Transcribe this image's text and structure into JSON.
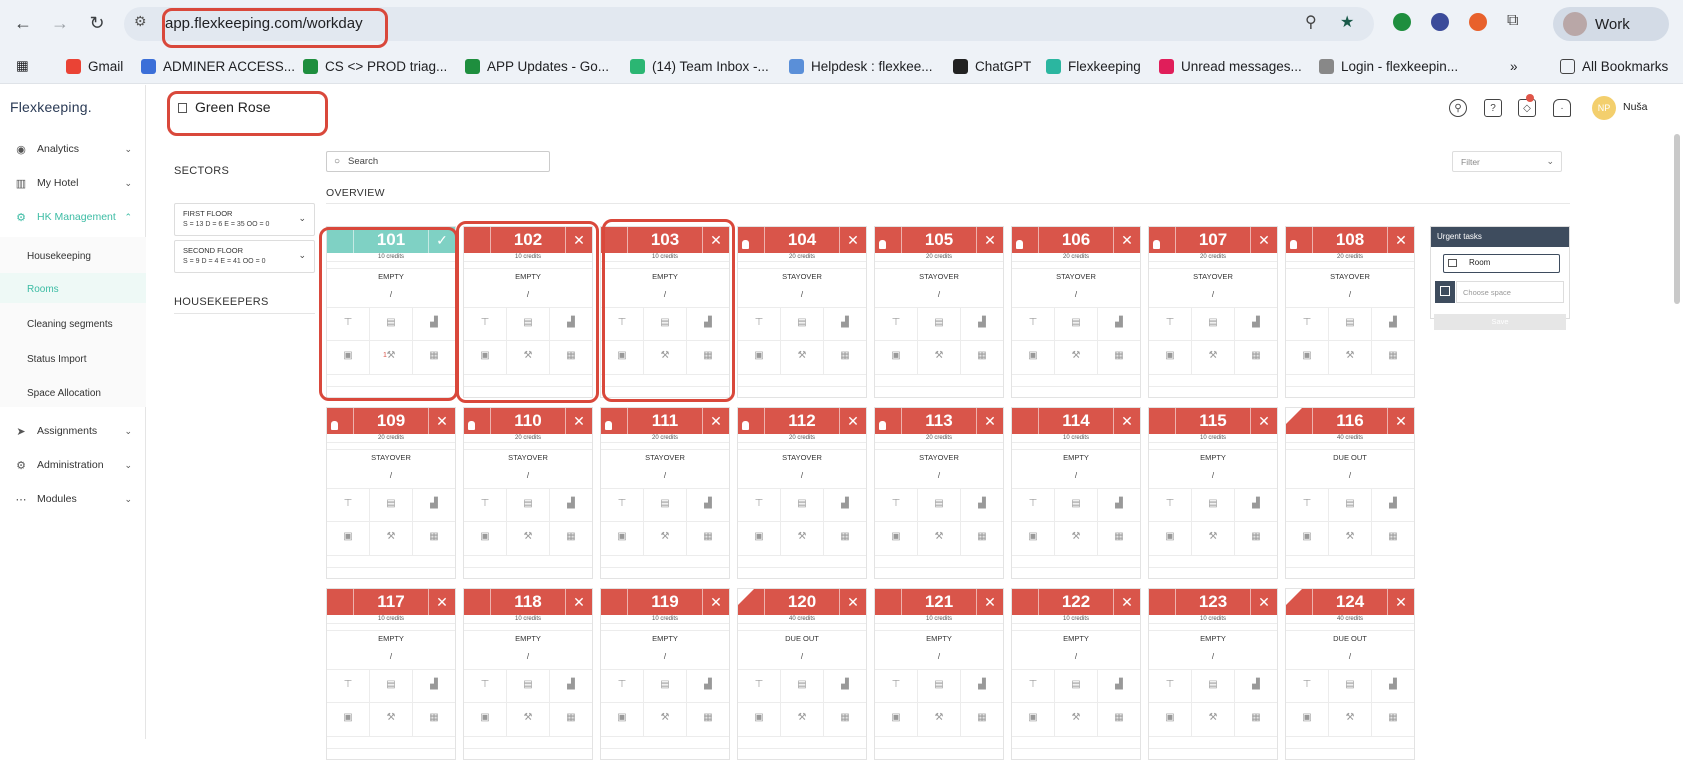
{
  "browser": {
    "url": "app.flexkeeping.com/workday",
    "profile_label": "Work",
    "bookmarks": [
      {
        "label": "Gmail",
        "color": "#ea4335"
      },
      {
        "label": "ADMINER ACCESS...",
        "color": "#3b6fd8"
      },
      {
        "label": "CS <> PROD triag...",
        "color": "#1e8e3e"
      },
      {
        "label": "APP Updates - Go...",
        "color": "#1e8e3e"
      },
      {
        "label": "(14) Team Inbox -...",
        "color": "#2bb673"
      },
      {
        "label": "Helpdesk : flexkee...",
        "color": "#5a8fd8"
      },
      {
        "label": "ChatGPT",
        "color": "#222222"
      },
      {
        "label": "Flexkeeping",
        "color": "#2bb6a0"
      },
      {
        "label": "Unread messages...",
        "color": "#e01e5a"
      },
      {
        "label": "Login - flexkeepin...",
        "color": "#888888"
      }
    ],
    "all_bookmarks": "All Bookmarks",
    "more": "»"
  },
  "app": {
    "logo": "Flexkeeping.",
    "hotel_name": "Green Rose",
    "user_initials": "NP",
    "user_name": "Nuša",
    "notification_count": "",
    "sidebar": [
      {
        "label": "Analytics",
        "icon": "eye-icon"
      },
      {
        "label": "My Hotel",
        "icon": "building-icon"
      },
      {
        "label": "HK Management",
        "icon": "gear-icon"
      },
      {
        "label": "Assignments",
        "icon": "send-icon"
      },
      {
        "label": "Administration",
        "icon": "gear-icon"
      },
      {
        "label": "Modules",
        "icon": "modules-icon"
      }
    ],
    "hk_submenu": [
      "Housekeeping",
      "Rooms",
      "Cleaning segments",
      "Status Import",
      "Space Allocation"
    ],
    "sectors_title": "SECTORS",
    "sectors": [
      {
        "name": "FIRST FLOOR",
        "stats": "S = 13 D = 6 E = 35 OO = 0"
      },
      {
        "name": "SECOND FLOOR",
        "stats": "S = 9 D = 4 E = 41 OO = 0"
      }
    ],
    "housekeepers_title": "HOUSEKEEPERS",
    "search_placeholder": "Search",
    "filter_placeholder": "Filter",
    "overview_title": "OVERVIEW",
    "urgent": {
      "title": "Urgent tasks",
      "room_label": "Room",
      "space_placeholder": "Choose space",
      "save_label": "Save"
    },
    "rooms": [
      {
        "number": "101",
        "credits": "10 credits",
        "status": "EMPTY",
        "state": "clean",
        "repair": "1"
      },
      {
        "number": "102",
        "credits": "10 credits",
        "status": "EMPTY",
        "state": "empty"
      },
      {
        "number": "103",
        "credits": "10 credits",
        "status": "EMPTY",
        "state": "empty"
      },
      {
        "number": "104",
        "credits": "20 credits",
        "status": "STAYOVER",
        "state": "stay"
      },
      {
        "number": "105",
        "credits": "20 credits",
        "status": "STAYOVER",
        "state": "stay"
      },
      {
        "number": "106",
        "credits": "20 credits",
        "status": "STAYOVER",
        "state": "stay"
      },
      {
        "number": "107",
        "credits": "20 credits",
        "status": "STAYOVER",
        "state": "stay"
      },
      {
        "number": "108",
        "credits": "20 credits",
        "status": "STAYOVER",
        "state": "stay"
      },
      {
        "number": "109",
        "credits": "20 credits",
        "status": "STAYOVER",
        "state": "stay"
      },
      {
        "number": "110",
        "credits": "20 credits",
        "status": "STAYOVER",
        "state": "stay"
      },
      {
        "number": "111",
        "credits": "20 credits",
        "status": "STAYOVER",
        "state": "stay"
      },
      {
        "number": "112",
        "credits": "20 credits",
        "status": "STAYOVER",
        "state": "stay"
      },
      {
        "number": "113",
        "credits": "20 credits",
        "status": "STAYOVER",
        "state": "stay"
      },
      {
        "number": "114",
        "credits": "10 credits",
        "status": "EMPTY",
        "state": "empty"
      },
      {
        "number": "115",
        "credits": "10 credits",
        "status": "EMPTY",
        "state": "empty"
      },
      {
        "number": "116",
        "credits": "40 credits",
        "status": "DUE OUT",
        "state": "due"
      },
      {
        "number": "117",
        "credits": "10 credits",
        "status": "EMPTY",
        "state": "empty"
      },
      {
        "number": "118",
        "credits": "10 credits",
        "status": "EMPTY",
        "state": "empty"
      },
      {
        "number": "119",
        "credits": "10 credits",
        "status": "EMPTY",
        "state": "empty"
      },
      {
        "number": "120",
        "credits": "40 credits",
        "status": "DUE OUT",
        "state": "due"
      },
      {
        "number": "121",
        "credits": "10 credits",
        "status": "EMPTY",
        "state": "empty"
      },
      {
        "number": "122",
        "credits": "10 credits",
        "status": "EMPTY",
        "state": "empty"
      },
      {
        "number": "123",
        "credits": "10 credits",
        "status": "EMPTY",
        "state": "empty"
      },
      {
        "number": "124",
        "credits": "40 credits",
        "status": "DUE OUT",
        "state": "due"
      }
    ],
    "colors": {
      "dirty": "#d9554a",
      "clean": "#7fd1c4",
      "accent": "#3cbca4"
    }
  }
}
